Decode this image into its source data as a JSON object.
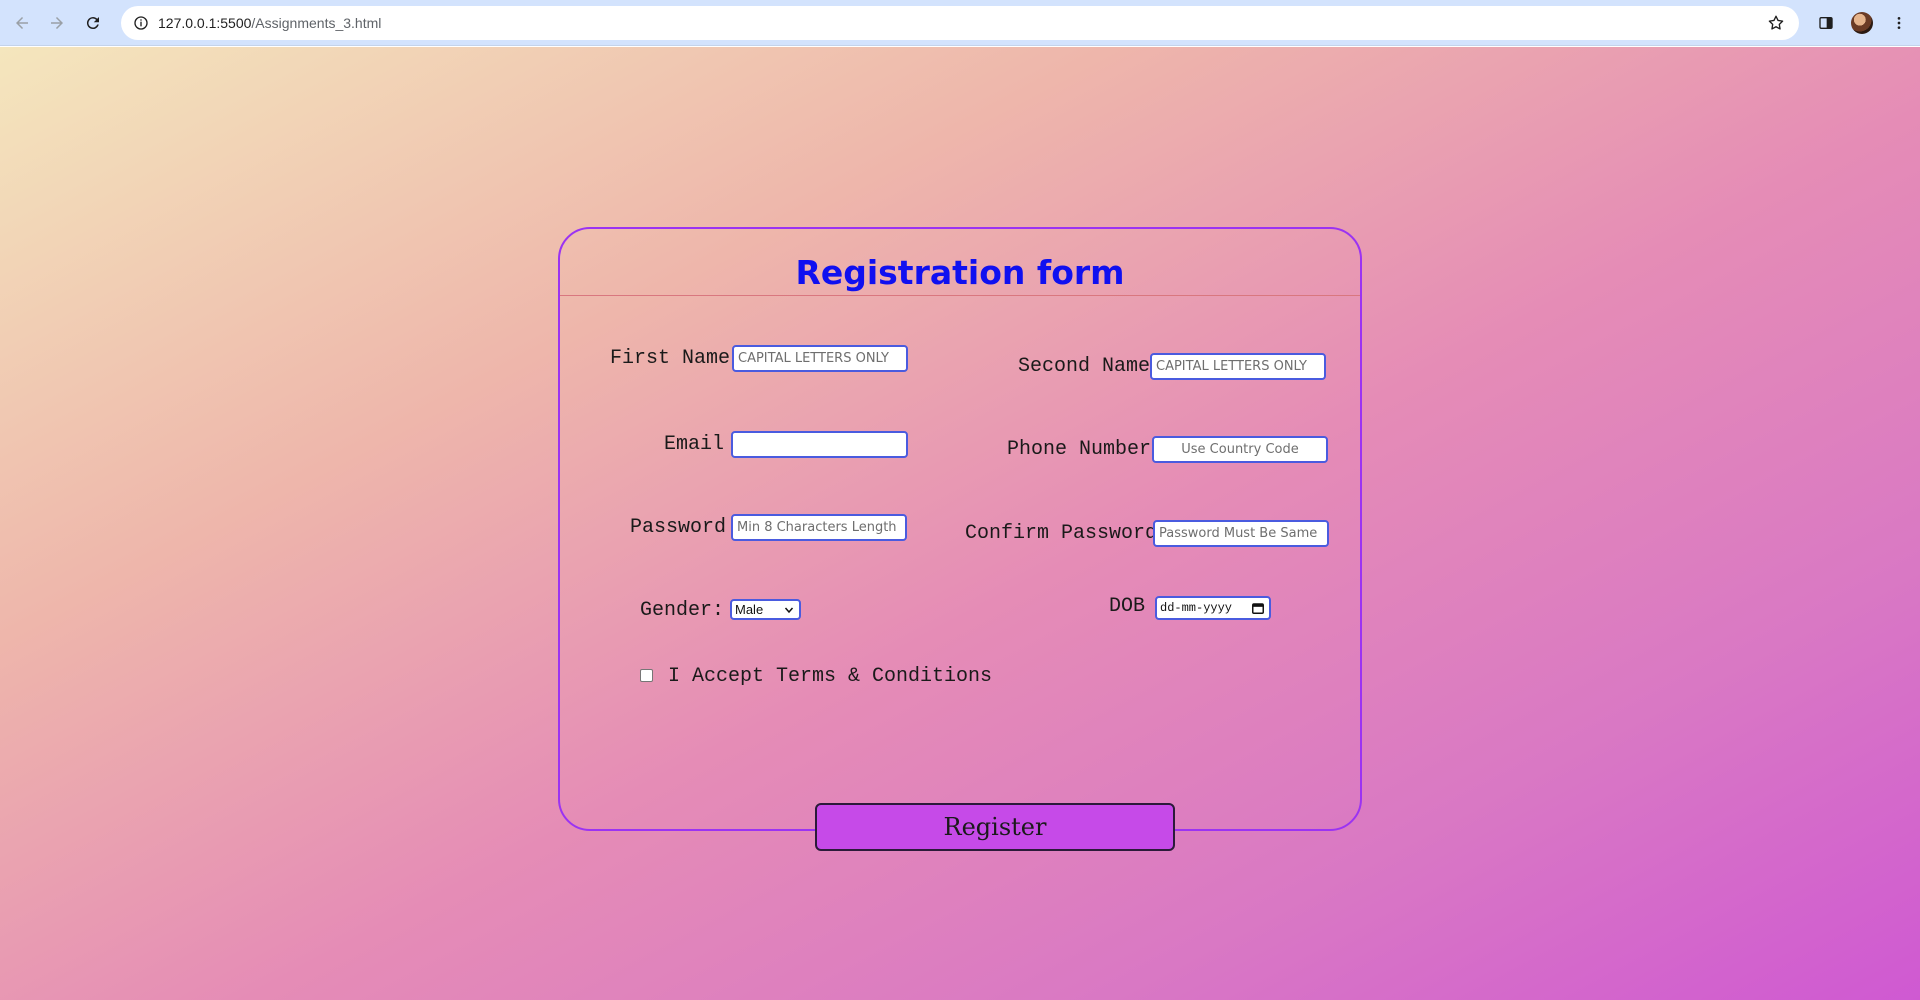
{
  "browser": {
    "url_host": "127.0.0.1:5500",
    "url_path": "/Assignments_3.html",
    "icons": [
      "back-arrow-icon",
      "forward-arrow-icon",
      "reload-icon",
      "site-info-icon",
      "bookmark-star-icon",
      "side-panel-icon",
      "profile-avatar",
      "more-menu-icon"
    ]
  },
  "form": {
    "title": "Registration form",
    "fields": {
      "first_name": {
        "label": "First Name",
        "placeholder": "CAPITAL LETTERS ONLY"
      },
      "second_name": {
        "label": "Second Name",
        "placeholder": "CAPITAL LETTERS ONLY"
      },
      "email": {
        "label": "Email",
        "placeholder": ""
      },
      "phone": {
        "label": "Phone Number",
        "placeholder": "Use Country Code"
      },
      "password": {
        "label": "Password",
        "placeholder": "Min 8 Characters Length"
      },
      "confirm_password": {
        "label": "Confirm Password",
        "placeholder": "Password Must Be Same"
      },
      "gender": {
        "label": "Gender:",
        "selected": "Male"
      },
      "dob": {
        "label": "DOB",
        "value": "dd-mm-yyyy"
      }
    },
    "terms_label": "I Accept Terms & Conditions",
    "register_label": "Register"
  },
  "colors": {
    "title": "#1010f0",
    "card_border": "#9b33f2",
    "input_border": "#4a5bdf",
    "button_bg": "#c64ae8"
  }
}
